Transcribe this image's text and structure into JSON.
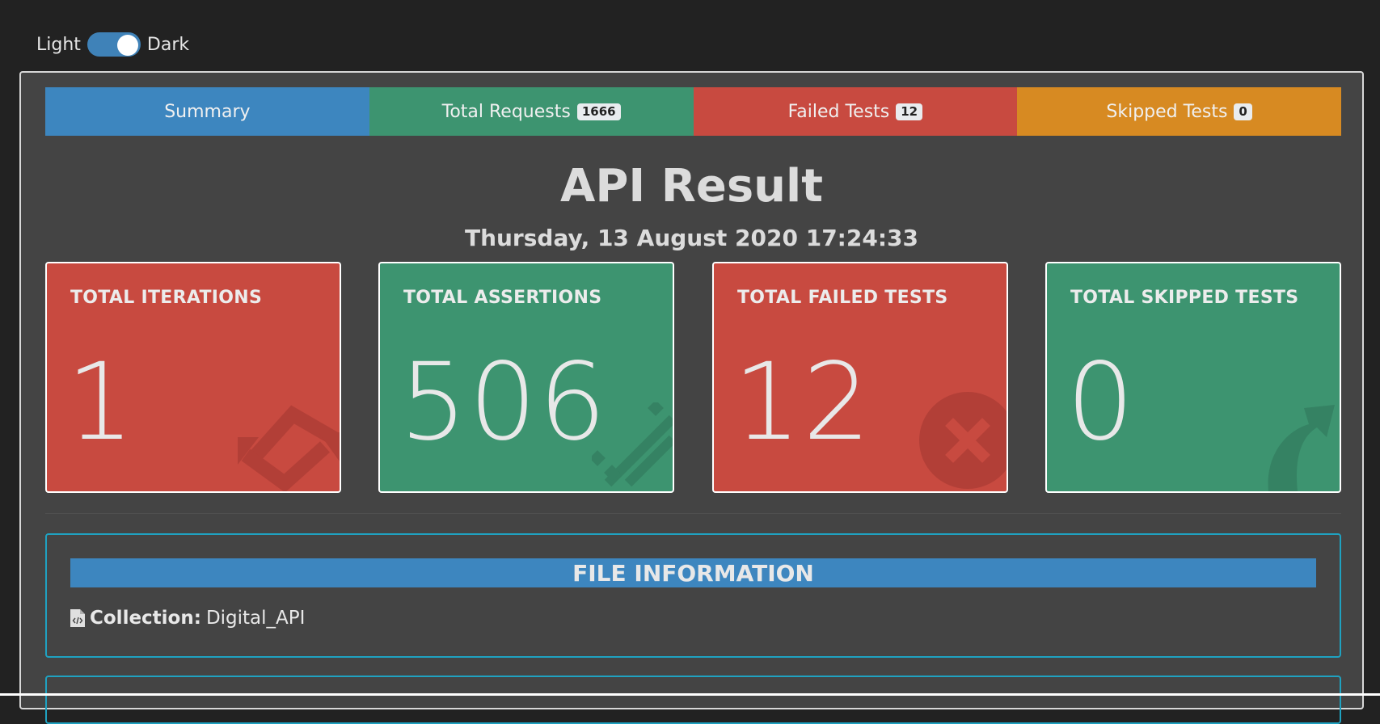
{
  "theme_toggle": {
    "light_label": "Light",
    "dark_label": "Dark"
  },
  "tabs": [
    {
      "label": "Summary",
      "badge": null
    },
    {
      "label": "Total Requests",
      "badge": "1666"
    },
    {
      "label": "Failed Tests",
      "badge": "12"
    },
    {
      "label": "Skipped Tests",
      "badge": "0"
    }
  ],
  "title": "API Result",
  "datetime": "Thursday, 13 August 2020 17:24:33",
  "cards": [
    {
      "label": "TOTAL ITERATIONS",
      "value": "1",
      "icon": "sync-icon",
      "color": "#c84a40"
    },
    {
      "label": "TOTAL ASSERTIONS",
      "value": "506",
      "icon": "tasks-icon",
      "color": "#3d9470"
    },
    {
      "label": "TOTAL FAILED TESTS",
      "value": "12",
      "icon": "times-circle-icon",
      "color": "#c84a40"
    },
    {
      "label": "TOTAL SKIPPED TESTS",
      "value": "0",
      "icon": "share-icon",
      "color": "#3d9470"
    }
  ],
  "file_info": {
    "header": "FILE INFORMATION",
    "collection_label": "Collection:",
    "collection_value": "Digital_API"
  },
  "colors": {
    "summary": "#3d86bf",
    "success": "#3d9470",
    "danger": "#c84a40",
    "warning": "#d78a22",
    "panel_border": "#1fa2c1"
  }
}
